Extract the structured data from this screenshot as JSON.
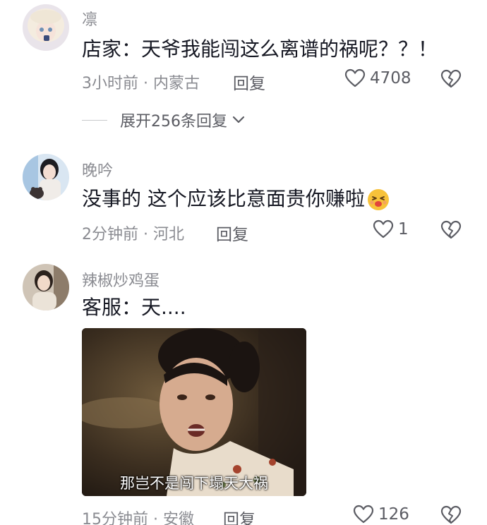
{
  "comments": [
    {
      "username": "凛",
      "text": "店家：天爷我能闯这么离谱的祸呢？？！",
      "meta": "3小时前 · 内蒙古",
      "reply_label": "回复",
      "likes": "4708",
      "expand_replies": "展开256条回复"
    },
    {
      "username": "晚吟",
      "text": "没事的 这个应该比意面贵你赚啦",
      "meta": "2分钟前 · 河北",
      "reply_label": "回复",
      "likes": "1"
    },
    {
      "username": "辣椒炒鸡蛋",
      "text": "客服：天....",
      "meta": "15分钟前 · 安徽",
      "reply_label": "回复",
      "likes": "126",
      "image_subtitle": "那岂不是闯下塌天大祸"
    }
  ],
  "colors": {
    "primary_text": "#161823",
    "secondary_text": "#8a8b91",
    "action_text": "#5b5c63"
  },
  "icons": [
    "heart-outline-icon",
    "broken-heart-icon",
    "chevron-down-icon",
    "kiss-emoji-icon"
  ]
}
